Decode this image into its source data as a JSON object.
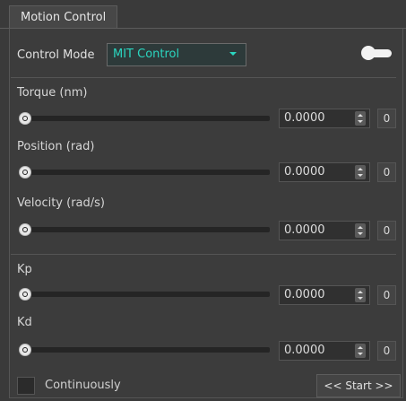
{
  "tab": {
    "label": "Motion Control"
  },
  "mode": {
    "label": "Control Mode",
    "selected": "MIT Control"
  },
  "toggle": {
    "state": "off"
  },
  "params": [
    {
      "label": "Torque (nm)",
      "value": "0.0000",
      "reset_label": "0",
      "slider_level": 0
    },
    {
      "label": "Position (rad)",
      "value": "0.0000",
      "reset_label": "0",
      "slider_level": 0
    },
    {
      "label": "Velocity (rad/s)",
      "value": "0.0000",
      "reset_label": "0",
      "slider_level": 0
    },
    {
      "label": "Kp",
      "value": "0.0000",
      "reset_label": "0",
      "slider_level": 0
    },
    {
      "label": "Kd",
      "value": "0.0000",
      "reset_label": "0",
      "slider_level": 0
    }
  ],
  "footer": {
    "checkbox_label": "Continuously",
    "checkbox_checked": false,
    "start_label": "<< Start >>"
  },
  "colors": {
    "accent": "#2bd6c0",
    "background": "#3a3a3a"
  }
}
